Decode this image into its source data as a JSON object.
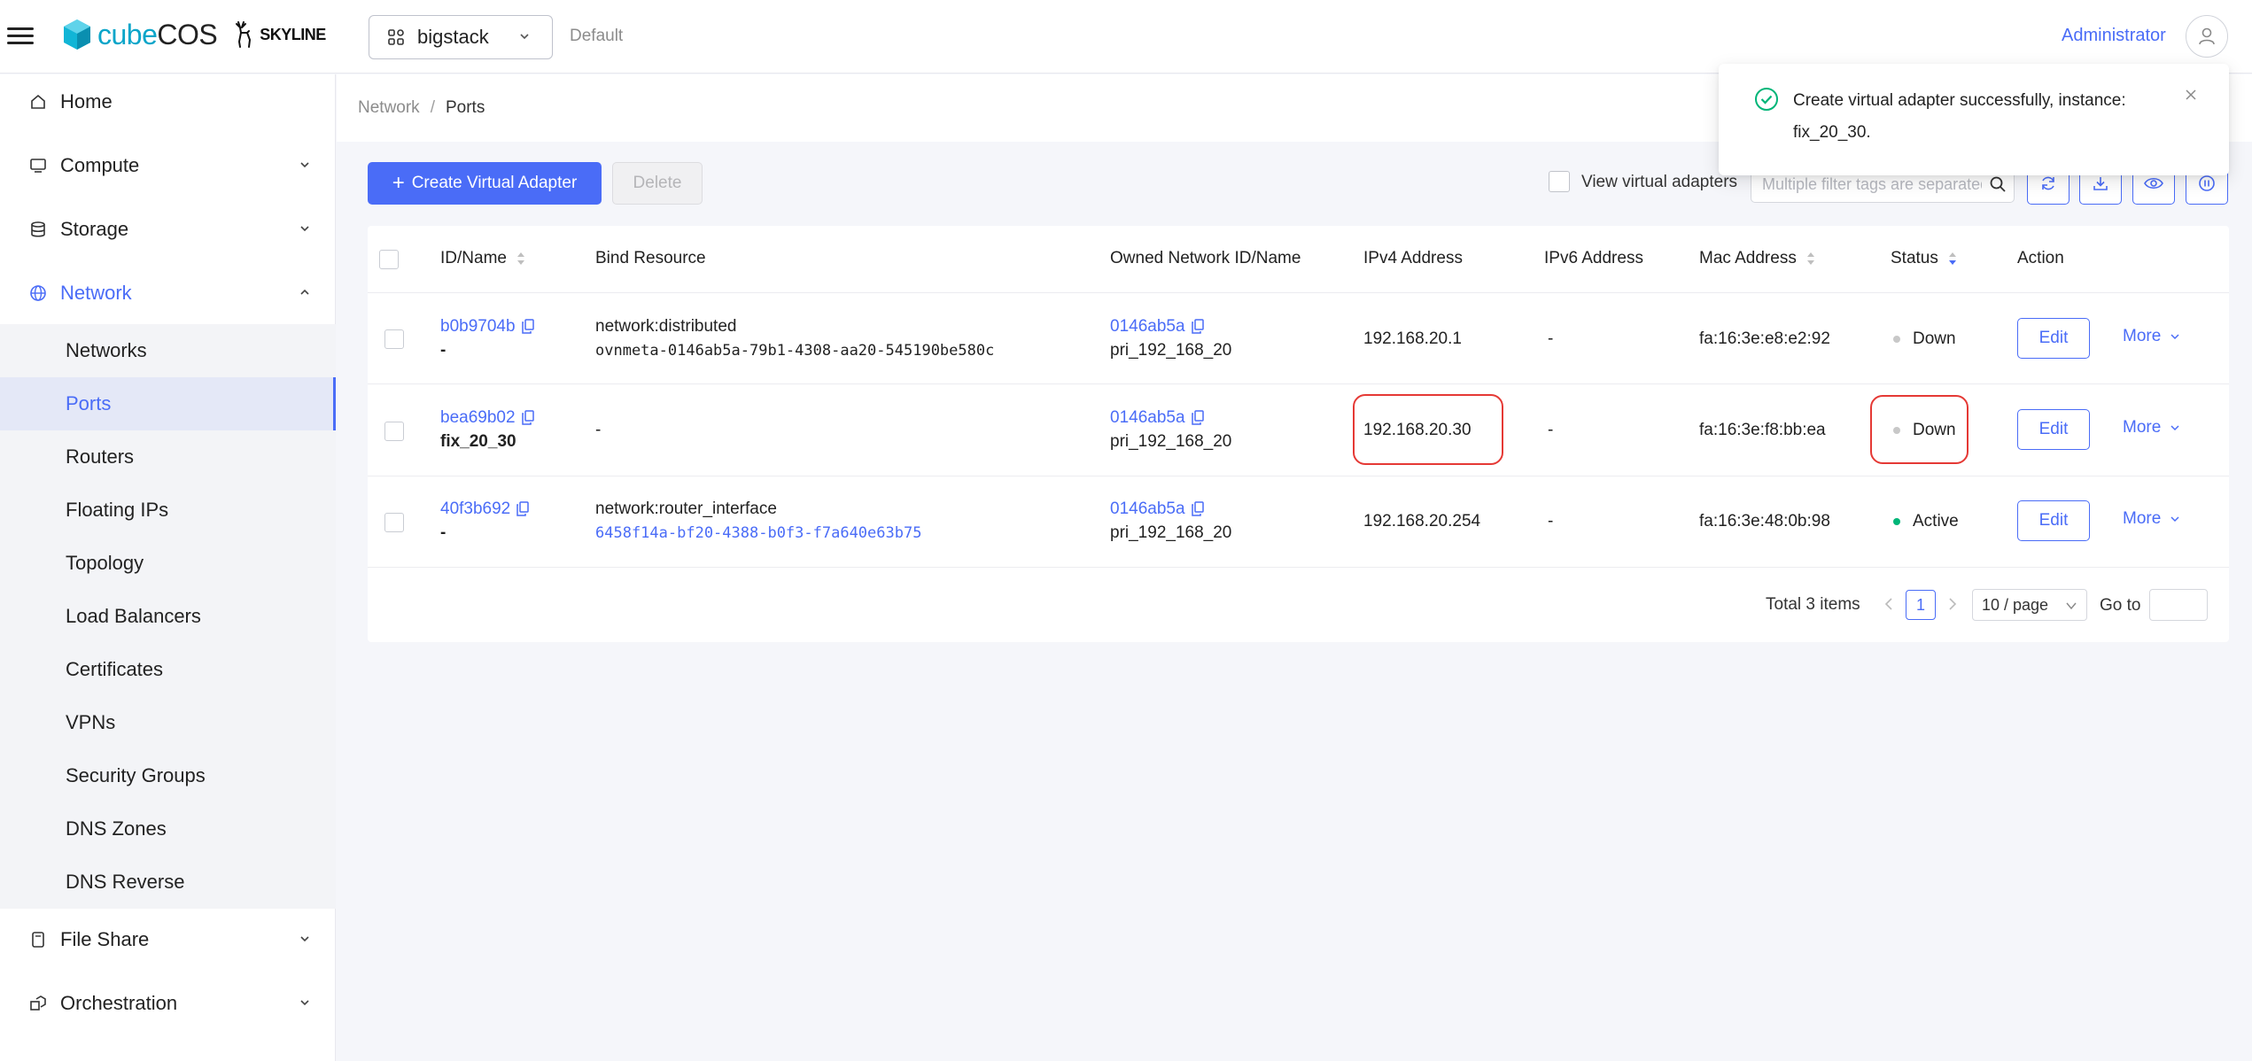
{
  "header": {
    "brand_cube": "cube",
    "brand_os": "COS",
    "partner": "SKYLINE",
    "project": "bigstack",
    "domain": "Default",
    "user": "Administrator"
  },
  "sidebar": {
    "items": [
      {
        "label": "Home",
        "icon": "home-icon"
      },
      {
        "label": "Compute",
        "icon": "monitor-icon"
      },
      {
        "label": "Storage",
        "icon": "database-icon"
      },
      {
        "label": "Network",
        "icon": "globe-icon"
      },
      {
        "label": "File Share",
        "icon": "file-share-icon"
      },
      {
        "label": "Orchestration",
        "icon": "orchestration-icon"
      }
    ],
    "network_sub": [
      "Networks",
      "Ports",
      "Routers",
      "Floating IPs",
      "Topology",
      "Load Balancers",
      "Certificates",
      "VPNs",
      "Security Groups",
      "DNS Zones",
      "DNS Reverse"
    ]
  },
  "breadcrumb": {
    "parent": "Network",
    "separator": "/",
    "current": "Ports"
  },
  "toolbar": {
    "create_label": "Create Virtual Adapter",
    "delete_label": "Delete",
    "view_virtual_label": "View virtual adapters",
    "filter_placeholder": "Multiple filter tags are separated by enter"
  },
  "table": {
    "headers": {
      "id_name": "ID/Name",
      "bind": "Bind Resource",
      "network": "Owned Network ID/Name",
      "ipv4": "IPv4 Address",
      "ipv6": "IPv6 Address",
      "mac": "Mac Address",
      "status": "Status",
      "action": "Action"
    },
    "rows": [
      {
        "id": "b0b9704b",
        "name": "-",
        "bind_line1": "network:distributed",
        "bind_line2": "ovnmeta-0146ab5a-79b1-4308-aa20-545190be580c",
        "net_id": "0146ab5a",
        "net_name": "pri_192_168_20",
        "ipv4": "192.168.20.1",
        "ipv6": "-",
        "mac": "fa:16:3e:e8:e2:92",
        "status": "Down",
        "edit": "Edit",
        "more": "More"
      },
      {
        "id": "bea69b02",
        "name": "fix_20_30",
        "bind_line1": "-",
        "bind_line2": "",
        "net_id": "0146ab5a",
        "net_name": "pri_192_168_20",
        "ipv4": "192.168.20.30",
        "ipv6": "-",
        "mac": "fa:16:3e:f8:bb:ea",
        "status": "Down",
        "edit": "Edit",
        "more": "More"
      },
      {
        "id": "40f3b692",
        "name": "-",
        "bind_line1": "network:router_interface",
        "bind_line2": "6458f14a-bf20-4388-b0f3-f7a640e63b75",
        "net_id": "0146ab5a",
        "net_name": "pri_192_168_20",
        "ipv4": "192.168.20.254",
        "ipv6": "-",
        "mac": "fa:16:3e:48:0b:98",
        "status": "Active",
        "edit": "Edit",
        "more": "More"
      }
    ]
  },
  "pagination": {
    "total": "Total 3 items",
    "current": "1",
    "page_size": "10 / page",
    "goto": "Go to"
  },
  "toast": {
    "message": "Create virtual adapter successfully, instance: fix_20_30."
  },
  "colors": {
    "accent": "#4a6cf7",
    "success": "#00b578",
    "down": "#c8c8c8",
    "highlight": "#e53935"
  }
}
